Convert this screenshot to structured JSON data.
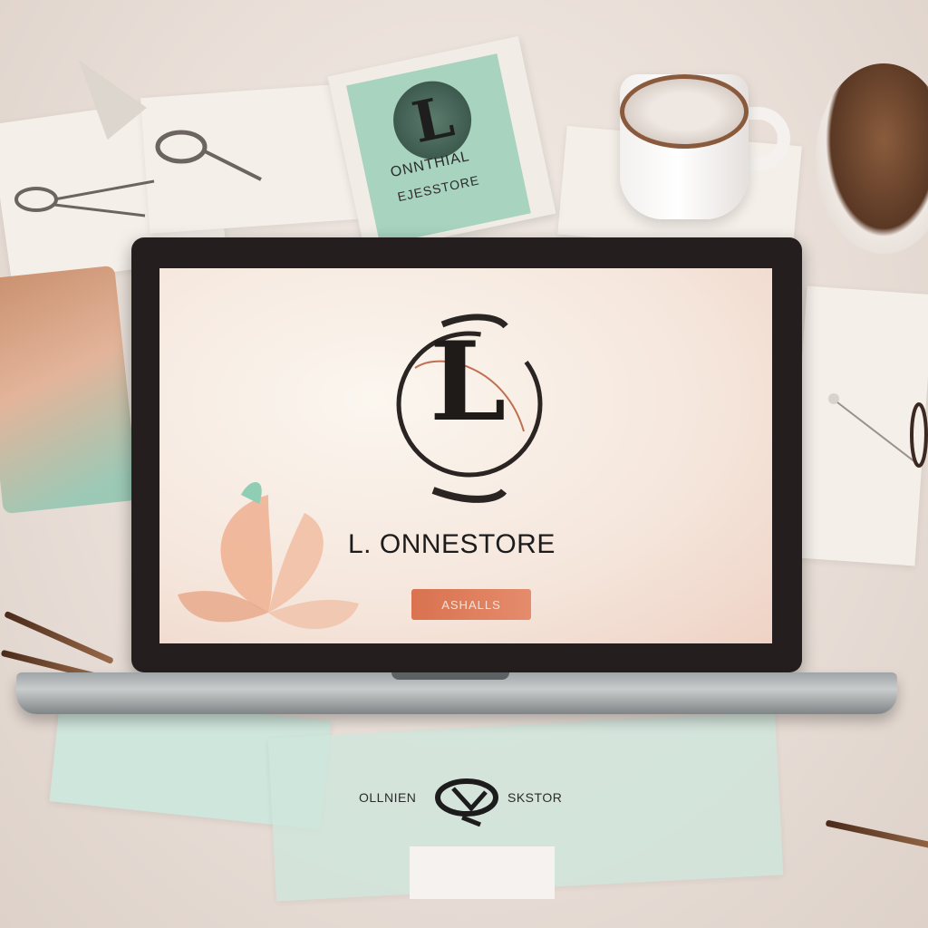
{
  "card": {
    "logo_letter": "L",
    "line1": "ONNTHIAL",
    "line2": "EJESSTORE"
  },
  "screen": {
    "emblem_letter": "L",
    "brand": "L. ONNESTORE",
    "cta_label": "ASHALLS"
  },
  "footer": {
    "left_text": "OLLNIEN",
    "right_text": "SKSTOR"
  },
  "colors": {
    "accent": "#e0805f",
    "mint": "#a7d3bf",
    "ink": "#1c1c1c"
  }
}
